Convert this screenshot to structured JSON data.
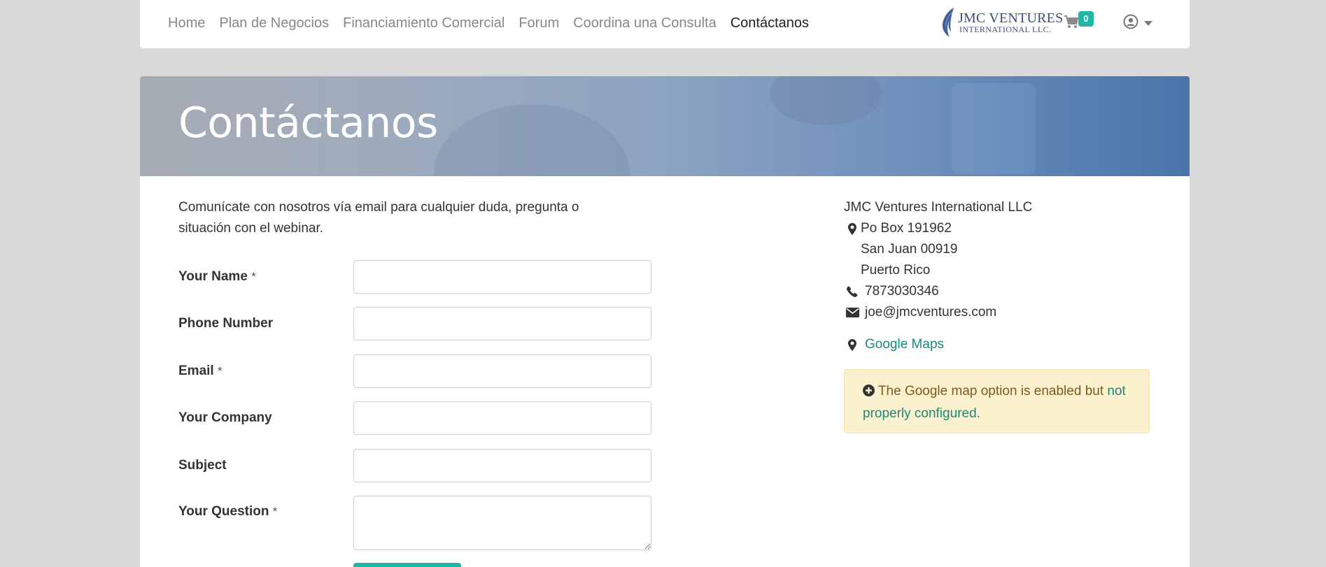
{
  "nav": {
    "links": [
      {
        "label": "Home"
      },
      {
        "label": "Plan de Negocios"
      },
      {
        "label": "Financiamiento Comercial"
      },
      {
        "label": "Forum"
      },
      {
        "label": "Coordina una Consulta"
      },
      {
        "label": "Contáctanos"
      }
    ],
    "active_index": 5,
    "logo": {
      "line1": "JMC VENTURES",
      "line2": "INTERNATIONAL LLC."
    },
    "cart_count": "0",
    "icons": {
      "cart": "cart-icon",
      "user": "user-circle-icon",
      "dropdown": "caret-down-icon"
    }
  },
  "hero": {
    "title": "Contáctanos"
  },
  "intro": "Comunícate con nosotros vía email para cualquier duda, pregunta o situación con el webinar.",
  "form": {
    "required_mark": "*",
    "fields": [
      {
        "label": "Your Name",
        "required": true,
        "value": ""
      },
      {
        "label": "Phone Number",
        "required": false,
        "value": ""
      },
      {
        "label": "Email",
        "required": true,
        "value": ""
      },
      {
        "label": "Your Company",
        "required": false,
        "value": ""
      },
      {
        "label": "Subject",
        "required": false,
        "value": ""
      },
      {
        "label": "Your Question",
        "required": true,
        "value": ""
      }
    ]
  },
  "contact": {
    "company": "JMC Ventures International LLC",
    "address_line1": "Po Box 191962",
    "address_line2": "San Juan 00919",
    "address_line3": "Puerto Rico",
    "phone": "7873030346",
    "email": "joe@jmcventures.com",
    "maps_label": "Google Maps",
    "icons": {
      "address": "map-marker-icon",
      "phone": "phone-icon",
      "email": "envelope-icon",
      "maps": "map-marker-icon"
    }
  },
  "alert": {
    "text": "The Google map option is enabled but",
    "link_text": "not properly configured",
    "suffix": ".",
    "icon": "plus-circle-icon"
  },
  "colors": {
    "accent": "#1eb7a4",
    "link": "#1a8a7a",
    "alert_bg": "#fbf1cf",
    "page_bg": "#d9d9d9"
  }
}
